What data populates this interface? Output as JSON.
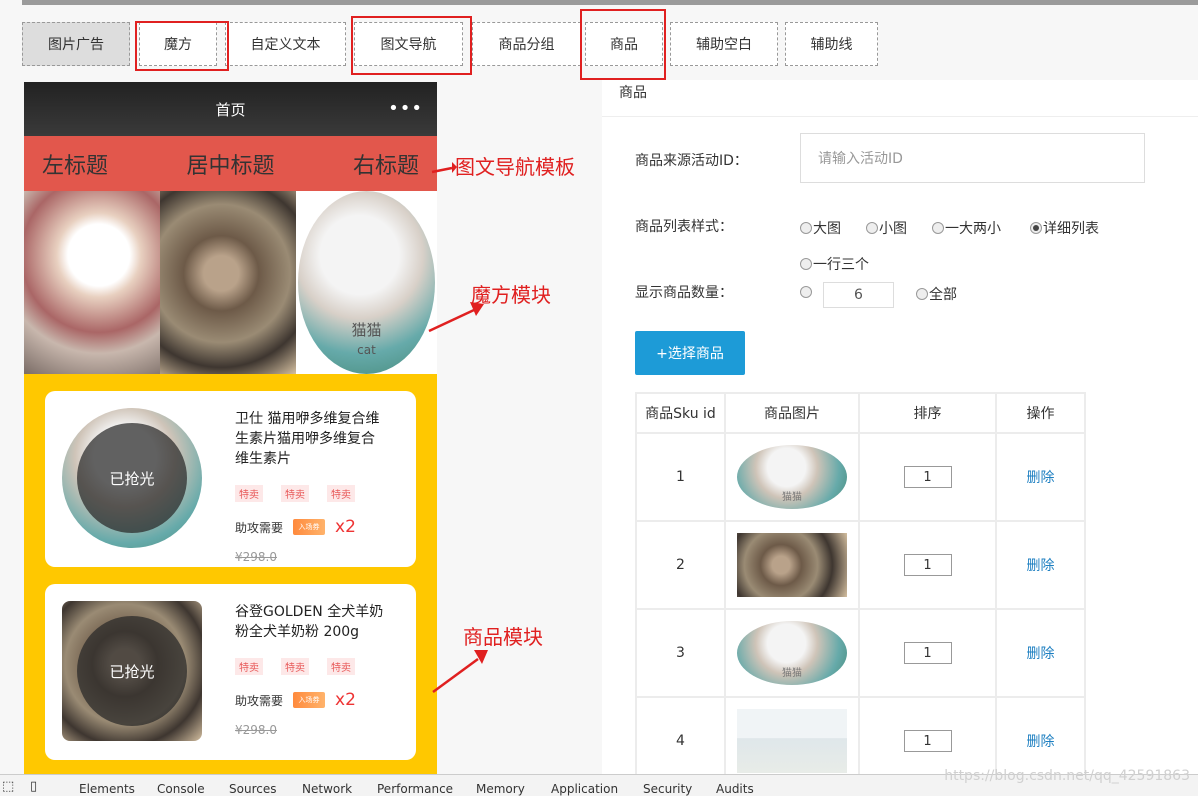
{
  "tabs": [
    "图片广告",
    "魔方",
    "自定义文本",
    "图文导航",
    "商品分组",
    "商品",
    "辅助空白",
    "辅助线"
  ],
  "phone": {
    "title": "首页",
    "menu": "•••",
    "nav": {
      "left": "左标题",
      "center": "居中标题",
      "right": "右标题"
    },
    "cube_cat_text": "猫猫",
    "cube_cat_sub": "cat",
    "goods": [
      {
        "title": "卫仕 猫用咿多维复合维生素片猫用咿多维复合维生素片",
        "status": "已抢光",
        "tags": [
          "特卖",
          "特卖",
          "特卖"
        ],
        "help": "助攻需要",
        "ticket": "入场券",
        "mult": "x2",
        "price": "¥298.0"
      },
      {
        "title": "谷登GOLDEN 全犬羊奶粉全犬羊奶粉 200g",
        "status": "已抢光",
        "tags": [
          "特卖",
          "特卖",
          "特卖"
        ],
        "help": "助攻需要",
        "ticket": "入场券",
        "mult": "x2",
        "price": "¥298.0"
      }
    ],
    "card1_cat_text": "猫猫"
  },
  "annotations": {
    "nav": "图文导航模板",
    "cube": "魔方模块",
    "goods": "商品模块"
  },
  "panel": {
    "title": "商品",
    "source_label": "商品来源活动ID：",
    "source_placeholder": "请输入活动ID",
    "style_label": "商品列表样式：",
    "style_options": [
      "大图",
      "小图",
      "一大两小",
      "详细列表",
      "一行三个"
    ],
    "count_label": "显示商品数量：",
    "count_value": "6",
    "count_all": "全部",
    "select_button": "+选择商品",
    "table_headers": [
      "商品Sku id",
      "商品图片",
      "排序",
      "操作"
    ],
    "rows": [
      {
        "id": "1",
        "sort": "1",
        "action": "删除",
        "img_text": "猫猫"
      },
      {
        "id": "2",
        "sort": "1",
        "action": "删除"
      },
      {
        "id": "3",
        "sort": "1",
        "action": "删除",
        "img_text": "猫猫"
      },
      {
        "id": "4",
        "sort": "1",
        "action": "删除"
      }
    ]
  },
  "devtools": [
    "Elements",
    "Console",
    "Sources",
    "Network",
    "Performance",
    "Memory",
    "Application",
    "Security",
    "Audits"
  ],
  "watermark": "https://blog.csdn.net/qq_42591863"
}
